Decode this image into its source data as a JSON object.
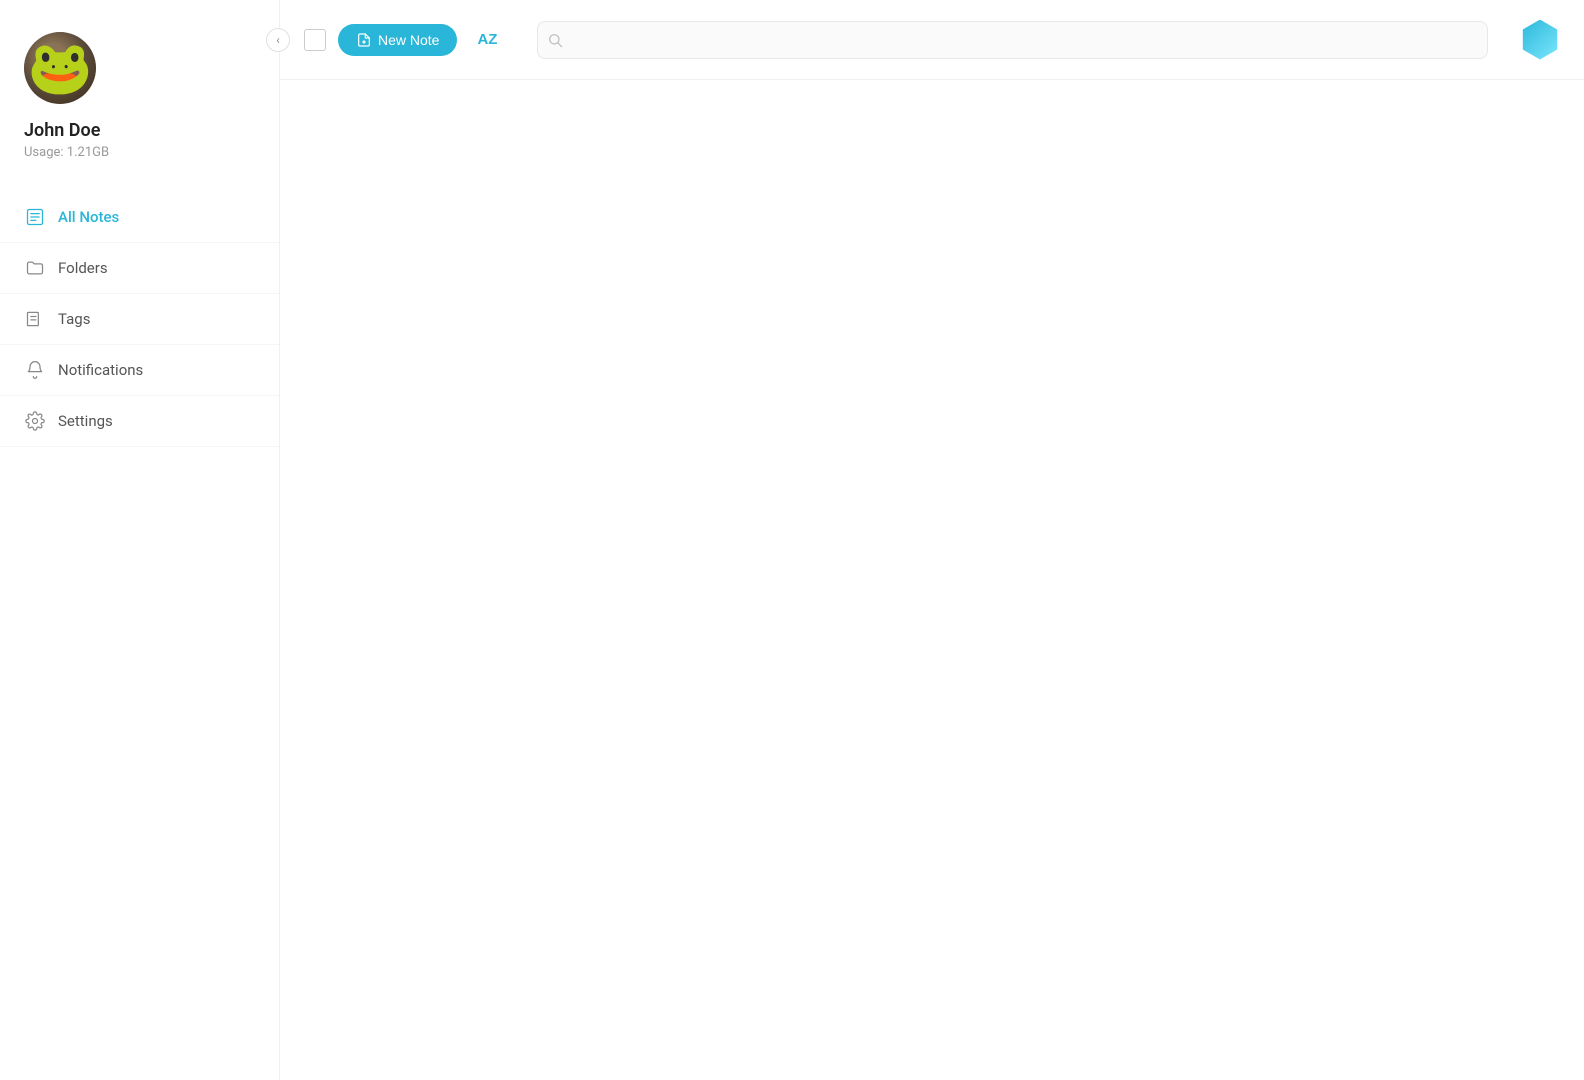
{
  "sidebar": {
    "collapse_button": "‹",
    "user": {
      "name": "John Doe",
      "usage": "Usage: 1.21GB"
    },
    "nav_items": [
      {
        "id": "all-notes",
        "label": "All Notes",
        "icon": "notes-icon",
        "active": true
      },
      {
        "id": "folders",
        "label": "Folders",
        "icon": "folder-icon",
        "active": false
      },
      {
        "id": "tags",
        "label": "Tags",
        "icon": "tag-icon",
        "active": false
      },
      {
        "id": "notifications",
        "label": "Notifications",
        "icon": "bell-icon",
        "active": false
      },
      {
        "id": "settings",
        "label": "Settings",
        "icon": "gear-icon",
        "active": false
      }
    ]
  },
  "toolbar": {
    "new_note_label": "New Note",
    "sort_label": "AZ",
    "search_placeholder": ""
  },
  "app_icon": "hexagon-app-icon"
}
